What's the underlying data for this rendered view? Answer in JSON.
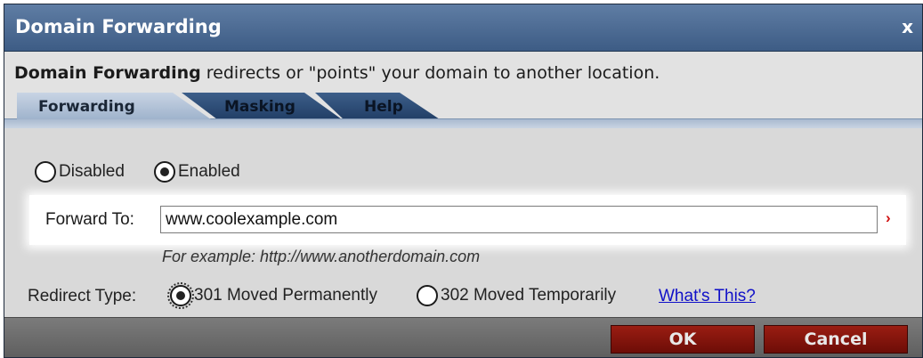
{
  "window": {
    "title": "Domain Forwarding",
    "close_glyph": "x"
  },
  "header": {
    "description_bold": "Domain Forwarding",
    "description_rest": " redirects or \"points\" your domain to another location."
  },
  "tabs": [
    {
      "label": "Forwarding",
      "active": true
    },
    {
      "label": "Masking",
      "active": false
    },
    {
      "label": "Help",
      "active": false
    }
  ],
  "status": {
    "options": [
      {
        "label": "Disabled",
        "selected": false
      },
      {
        "label": "Enabled",
        "selected": true
      }
    ]
  },
  "forward": {
    "label": "Forward To:",
    "value": "www.coolexample.com",
    "marker": "›",
    "example": "For example: http://www.anotherdomain.com"
  },
  "redirect": {
    "label": "Redirect Type:",
    "options": [
      {
        "label": "301 Moved Permanently",
        "selected": true
      },
      {
        "label": "302 Moved Temporarily",
        "selected": false
      }
    ],
    "help_link": "What's This?"
  },
  "footer": {
    "ok_label": "OK",
    "cancel_label": "Cancel"
  },
  "colors": {
    "titlebar": "#4a6a93",
    "tab_active": "#b4c4d9",
    "tab_inactive": "#2c4b74",
    "button": "#8a170e",
    "link": "#1010c8"
  }
}
